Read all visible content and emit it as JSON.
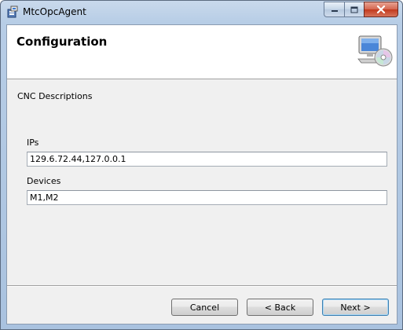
{
  "window": {
    "title": "MtcOpcAgent",
    "controls": {
      "minimize": "minimize",
      "maximize": "maximize",
      "close": "close"
    }
  },
  "banner": {
    "title": "Configuration",
    "icon": "computer-cd-icon"
  },
  "section": {
    "label": "CNC Descriptions"
  },
  "form": {
    "ips": {
      "label": "IPs",
      "value": "129.6.72.44,127.0.0.1"
    },
    "devices": {
      "label": "Devices",
      "value": "M1,M2"
    }
  },
  "buttons": {
    "cancel": "Cancel",
    "back": "< Back",
    "next": "Next >"
  },
  "colors": {
    "titlebar": "#b7cde6",
    "close_button": "#c2391d",
    "client_bg": "#f0f0f0",
    "default_button_border": "#3c7fb1"
  }
}
